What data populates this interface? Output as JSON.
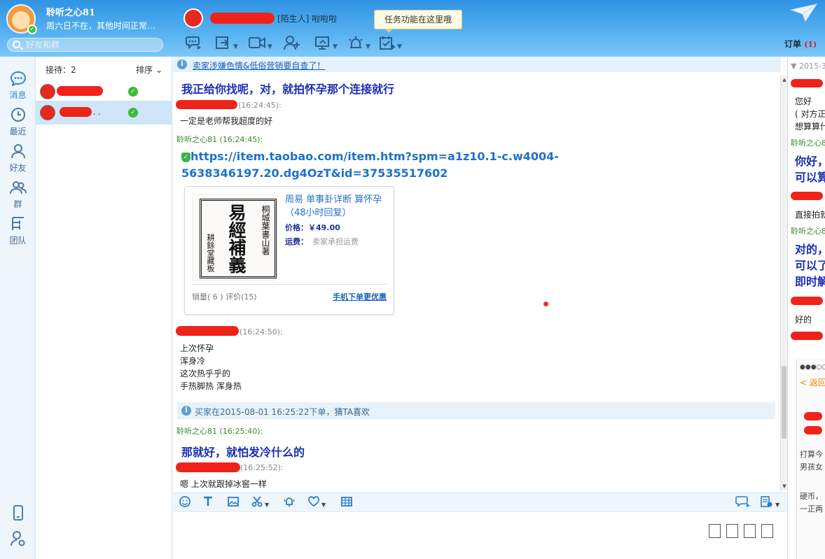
{
  "header": {
    "user_name": "聆听之心81",
    "user_status": "周六日不在，其他时间正常…",
    "search_placeholder": "好友和群",
    "contact_tag": "[陌生人] 啦啦啦",
    "tooltip": "任务功能在这里哦",
    "order_label": "订单",
    "order_count": "(1)"
  },
  "nav": {
    "items": [
      {
        "label": "消息",
        "icon": "chat-bubble-icon"
      },
      {
        "label": "最近",
        "icon": "clock-icon"
      },
      {
        "label": "好友",
        "icon": "person-icon"
      },
      {
        "label": "群",
        "icon": "group-icon"
      },
      {
        "label": "团队",
        "icon": "org-tree-icon"
      }
    ],
    "bottom_icons": [
      "phone-icon",
      "person-settings-icon"
    ]
  },
  "contact_list": {
    "count_label": "接待：2",
    "sort_label": "排序 ⌄",
    "rows": [
      {
        "status": "online"
      },
      {
        "status": "online",
        "suffix": ". ."
      }
    ]
  },
  "chat": {
    "notice_link": "卖家涉嫌色情&低俗营销要自查了！",
    "messages": {
      "m1_text": "我正给你找呢，对，就拍怀孕那个连接就行",
      "m2_time": "(16:24:45):",
      "m2_text": "一定是老师帮我超度的好",
      "m3_sender": "聆听之心81 (16:24:45):",
      "m3_link": "https://item.taobao.com/item.htm?spm=a1z10.1-c.w4004-5638346197.20.dg4OzT&id=37535517602",
      "m4_time": "(16:24:50):",
      "m4_lines": [
        "上次怀孕",
        "浑身冷",
        "这次热乎乎的",
        "手热脚热  浑身热"
      ],
      "m5_sender": "聆听之心81 (16:25:40):",
      "m5_text": "那就好，就怕发冷什么的",
      "m6_time": "(16:25:52):",
      "m6_text": "嗯  上次就跟掉冰窖一样"
    },
    "product_card": {
      "title": "周易 单事卦详断 算怀孕（48小时回复）",
      "price_label": "价格：",
      "price": "￥49.00",
      "ship_label": "运费：",
      "ship_value": "卖家承担运费",
      "sales": "销量( 6 ) 评价(15)",
      "mobile_link": "手机下单更优惠",
      "book_title": "易經補義",
      "book_author": "桐城葉書山著",
      "book_publisher": "耕餘堂藏板"
    },
    "system_notice": {
      "text": "买家在2015-08-01 16:25:22下单，",
      "link": "猜TA喜欢"
    }
  },
  "right_panel": {
    "date": "▼ 2015-3-",
    "lines": [
      "您好",
      "( 对方正",
      "想算算什"
    ],
    "me1": "聆听之心8",
    "big1": [
      "你好，",
      "可以算"
    ],
    "line2": "直接拍就",
    "me2": "聆听之心8",
    "big2": [
      "对的，",
      "可以了",
      "即时解"
    ],
    "line3": "好的",
    "phone_lines": [
      "●●●○○ 中",
      "< 返回",
      "打算今",
      "男孩女",
      "硬币，",
      "一正两"
    ]
  }
}
